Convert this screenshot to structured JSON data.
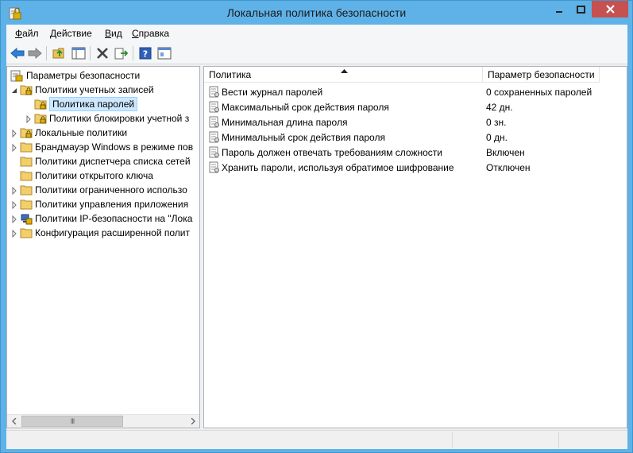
{
  "window": {
    "title": "Локальная политика безопасности",
    "icon": "security-policy-icon",
    "controls": [
      "minimize-icon",
      "maximize-icon",
      "close-icon"
    ]
  },
  "menu": {
    "items": [
      {
        "label": "Файл"
      },
      {
        "label": "Действие"
      },
      {
        "label": "Вид"
      },
      {
        "label": "Справка"
      }
    ]
  },
  "toolbar": {
    "buttons": [
      "back-icon",
      "forward-icon",
      "up-folder-icon",
      "show-hide-tree-icon",
      "delete-icon",
      "export-list-icon",
      "help-icon",
      "properties-icon"
    ]
  },
  "tree": {
    "root": "Параметры безопасности",
    "items": [
      {
        "label": "Политики учетных записей",
        "expanded": true
      },
      {
        "label": "Политика паролей",
        "selected": true
      },
      {
        "label": "Политики блокировки учетной з"
      },
      {
        "label": "Локальные политики"
      },
      {
        "label": "Брандмауэр Windows в режиме пов"
      },
      {
        "label": "Политики диспетчера списка сетей"
      },
      {
        "label": "Политики открытого ключа"
      },
      {
        "label": "Политики ограниченного использо"
      },
      {
        "label": "Политики управления приложения"
      },
      {
        "label": "Политики IP-безопасности на \"Лока"
      },
      {
        "label": "Конфигурация расширенной полит"
      }
    ],
    "scroll_thumb": "III"
  },
  "list": {
    "columns": [
      "Политика",
      "Параметр безопасности"
    ],
    "rows": [
      {
        "policy": "Вести журнал паролей",
        "value": "0 сохраненных паролей"
      },
      {
        "policy": "Максимальный срок действия пароля",
        "value": "42 дн."
      },
      {
        "policy": "Минимальная длина пароля",
        "value": "0 зн."
      },
      {
        "policy": "Минимальный срок действия пароля",
        "value": "0 дн."
      },
      {
        "policy": "Пароль должен отвечать требованиям сложности",
        "value": "Включен"
      },
      {
        "policy": "Хранить пароли, используя обратимое шифрование",
        "value": "Отключен"
      }
    ]
  },
  "colors": {
    "titlebar": "#5fb2e8",
    "close_button": "#c75050",
    "selection": "#cce8ff"
  }
}
